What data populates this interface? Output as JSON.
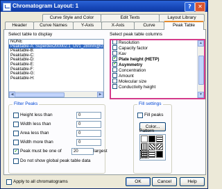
{
  "window": {
    "title": "Chromatogram Layout: 1",
    "help_glyph": "?",
    "close_glyph": "✕"
  },
  "tabs": {
    "row1": [
      "Curve Style and Color",
      "Edit Texts",
      "Layout Library"
    ],
    "row2": [
      "Header",
      "Curve Names",
      "Y-Axis",
      "X-Axis",
      "Curve",
      "Peak Table"
    ],
    "active": "Peak Table"
  },
  "left": {
    "label": "Select table to display",
    "items": [
      "NONE",
      "Peaktable-A: Superdex200002:1_UV1_280nm@01,B",
      "Peaktable-B:",
      "Peaktable-C:",
      "Peaktable-D:",
      "Peaktable-E:",
      "Peaktable-F:",
      "Peaktable-G:",
      "Peaktable-H:"
    ],
    "selected_index": 1
  },
  "right": {
    "label": "Select peak table columns",
    "columns": [
      {
        "label": "Resolution",
        "checked": false,
        "bold": false
      },
      {
        "label": "Capacity factor",
        "checked": false,
        "bold": false
      },
      {
        "label": "Kav",
        "checked": false,
        "bold": false
      },
      {
        "label": "Plate height (HETP)",
        "checked": true,
        "bold": true
      },
      {
        "label": "Asymmetry",
        "checked": true,
        "bold": true
      },
      {
        "label": "Concentration",
        "checked": false,
        "bold": false
      },
      {
        "label": "Amount",
        "checked": false,
        "bold": false
      },
      {
        "label": "Molecular size",
        "checked": false,
        "bold": false
      },
      {
        "label": "Conductivity height",
        "checked": false,
        "bold": false
      }
    ]
  },
  "filter": {
    "title": "Filter Peaks",
    "rows": [
      {
        "label": "Height less than",
        "checked": false,
        "value": "0"
      },
      {
        "label": "Width less than",
        "checked": false,
        "value": "0"
      },
      {
        "label": "Area less than",
        "checked": false,
        "value": "0"
      },
      {
        "label": "Width more than",
        "checked": false,
        "value": "0"
      },
      {
        "label": "Peak must be one of",
        "checked": true,
        "value": "20",
        "suffix": "largest"
      }
    ],
    "global": {
      "label": "Do not show global peak table data",
      "checked": false
    }
  },
  "fill": {
    "title": "Fill settings",
    "fill_peaks": {
      "label": "Fill peaks",
      "checked": false
    },
    "color_button": "Color...",
    "pattern_label": "Pattern"
  },
  "bottom": {
    "apply_all": {
      "label": "Apply to all chromatograms",
      "checked": false
    },
    "ok": "OK",
    "cancel": "Cancel",
    "help": "Help"
  },
  "colors": {
    "title_bar": "#1747b8",
    "highlight": "#d43a8a",
    "selection": "#316ac5"
  }
}
